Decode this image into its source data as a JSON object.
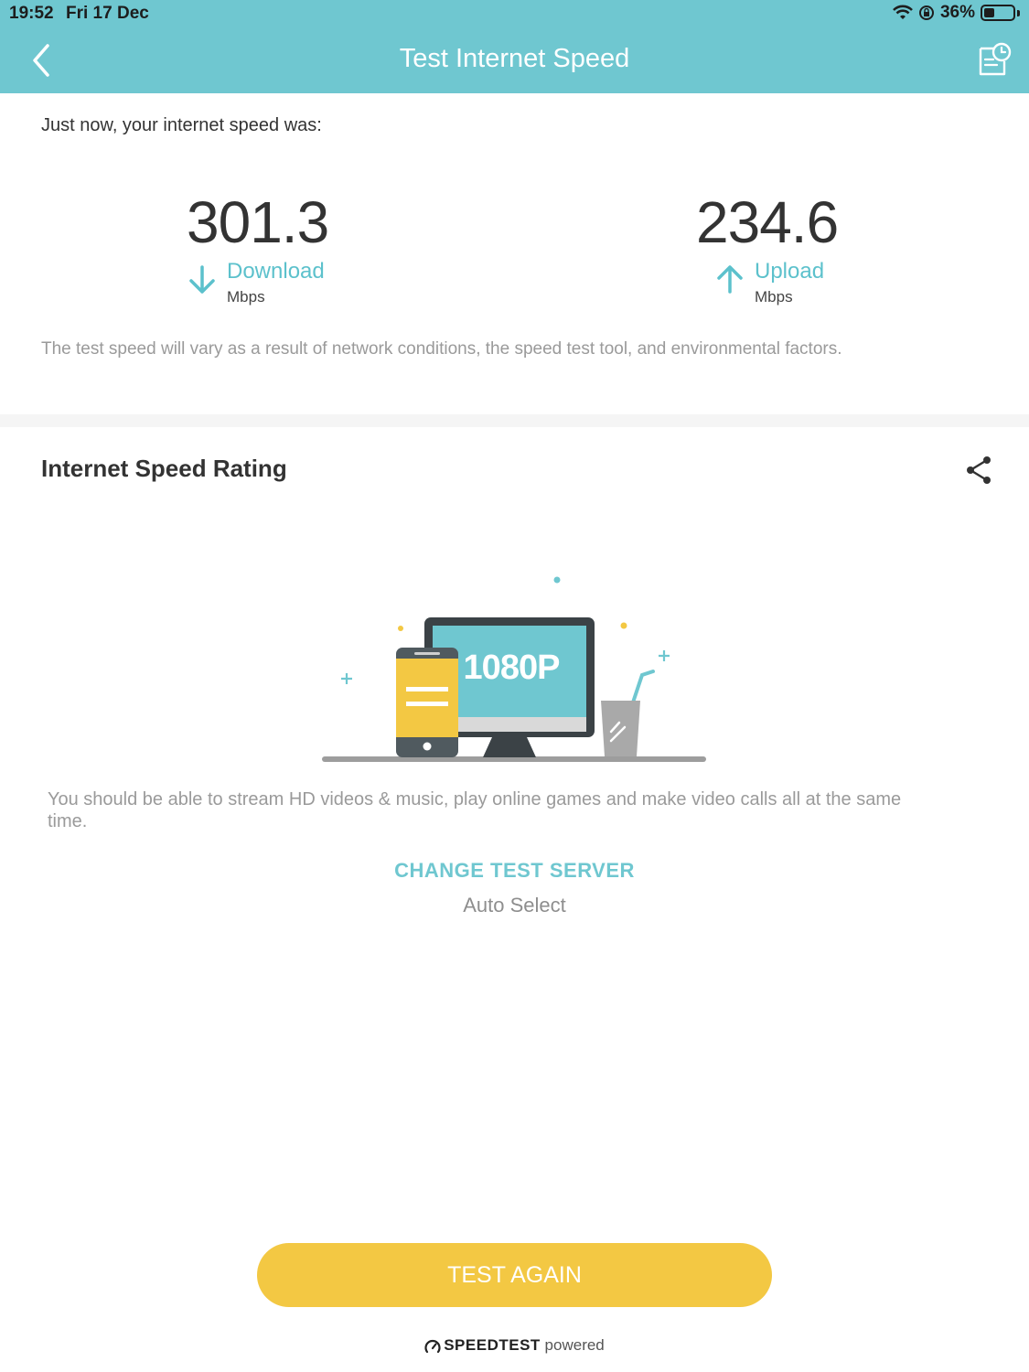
{
  "status_bar": {
    "time": "19:52",
    "date": "Fri 17 Dec",
    "battery": "36%",
    "battery_level": 0.36
  },
  "nav": {
    "title": "Test Internet Speed"
  },
  "result": {
    "intro": "Just now, your internet speed was:",
    "download": {
      "value": "301.3",
      "label": "Download",
      "unit": "Mbps"
    },
    "upload": {
      "value": "234.6",
      "label": "Upload",
      "unit": "Mbps"
    },
    "disclaimer": "The test speed will vary as a result of network conditions, the speed test tool, and environmental factors."
  },
  "rating": {
    "title": "Internet Speed Rating",
    "screen_text": "1080P",
    "description": "You should be able to stream HD videos & music, play online games and make video calls all at the same time.",
    "change_server_label": "CHANGE TEST SERVER",
    "server_value": "Auto Select"
  },
  "actions": {
    "test_again_label": "TEST AGAIN"
  },
  "footer": {
    "brand": "SPEEDTEST",
    "powered": "powered"
  },
  "colors": {
    "accent": "#6fc7d0",
    "button": "#f3c843",
    "text_dark": "#333333",
    "text_muted": "#9a9a9a"
  }
}
